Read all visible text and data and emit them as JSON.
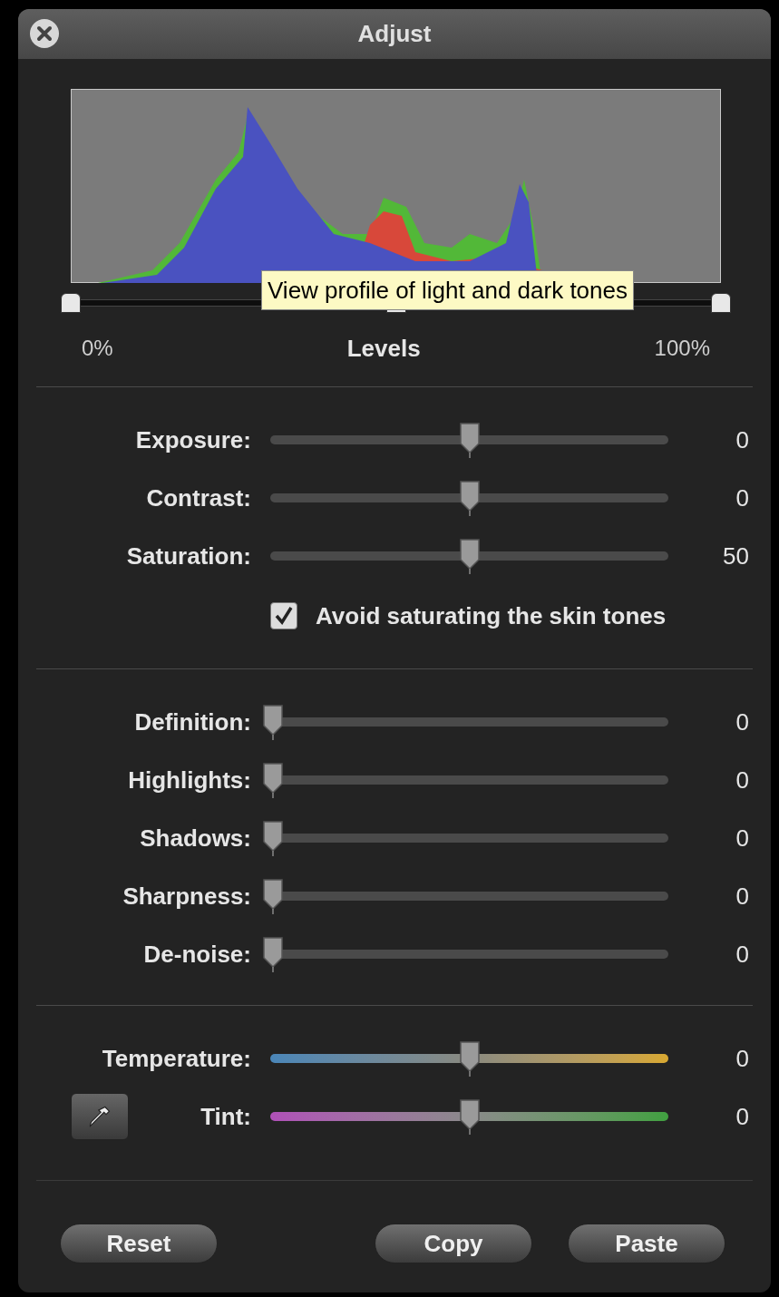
{
  "window": {
    "title": "Adjust"
  },
  "histogram": {
    "tooltip": "View profile of light and dark tones",
    "thumbs": [
      {
        "level": 0
      },
      {
        "level": 0.5
      },
      {
        "level": 1
      }
    ],
    "min_label": "0%",
    "label": "Levels",
    "max_label": "100%"
  },
  "sections": [
    {
      "rows": [
        {
          "kind": "slider",
          "label": "Exposure:",
          "level": 0.5,
          "value": "0"
        },
        {
          "kind": "slider",
          "label": "Contrast:",
          "level": 0.5,
          "value": "0"
        },
        {
          "kind": "slider",
          "label": "Saturation:",
          "level": 0.5,
          "value": "50"
        },
        {
          "kind": "checkbox",
          "label": "Avoid saturating the skin tones",
          "checked": true
        }
      ]
    },
    {
      "rows": [
        {
          "kind": "slider",
          "label": "Definition:",
          "level": 0,
          "value": "0"
        },
        {
          "kind": "slider",
          "label": "Highlights:",
          "level": 0,
          "value": "0"
        },
        {
          "kind": "slider",
          "label": "Shadows:",
          "level": 0,
          "value": "0"
        },
        {
          "kind": "slider",
          "label": "Sharpness:",
          "level": 0,
          "value": "0"
        },
        {
          "kind": "slider",
          "label": "De-noise:",
          "level": 0,
          "value": "0"
        }
      ]
    },
    {
      "rows": [
        {
          "kind": "temperature",
          "label": "Temperature:",
          "level": 0.5,
          "value": "0"
        },
        {
          "kind": "tint",
          "label": "Tint:",
          "level": 0.5,
          "value": "0",
          "eyedropper": true
        }
      ]
    }
  ],
  "buttons": [
    {
      "label": "Reset"
    },
    {
      "label": "Copy"
    },
    {
      "label": "Paste"
    }
  ]
}
